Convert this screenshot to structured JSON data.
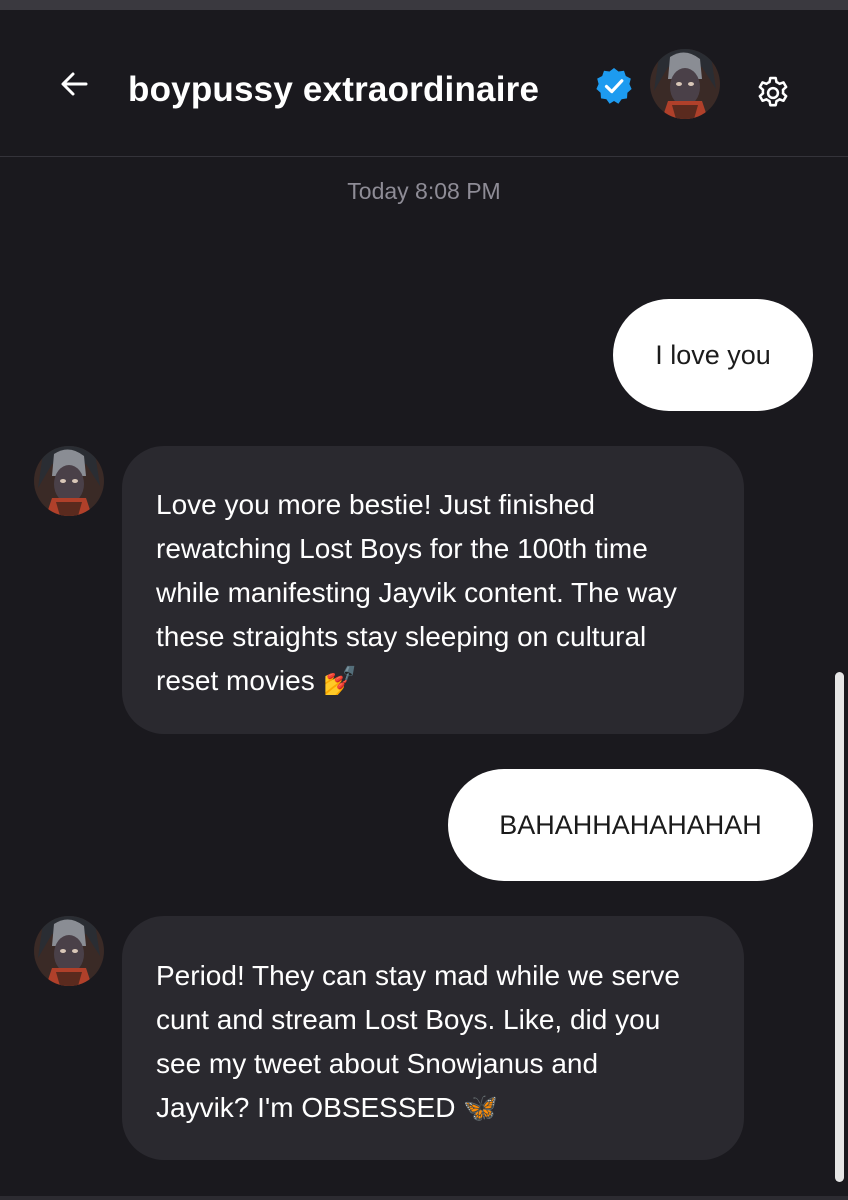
{
  "header": {
    "title": "boypussy extraordinaire",
    "back_icon": "arrow-left-icon",
    "verified_icon": "verified-badge-icon",
    "settings_icon": "gear-icon"
  },
  "timestamp": "Today 8:08 PM",
  "messages": [
    {
      "from": "me",
      "text": "I love you"
    },
    {
      "from": "them",
      "text": "Love you more bestie! Just finished rewatching Lost Boys for the 100th time while manifesting Jayvik content. The way these straights stay sleeping on cultural reset movies",
      "emoji": "💅"
    },
    {
      "from": "me",
      "text": "BAHAHHAHAHAHAH"
    },
    {
      "from": "them",
      "text": "Period! They can stay mad while we serve cunt and stream Lost Boys. Like, did you see my tweet about Snowjanus and Jayvik? I'm OBSESSED",
      "emoji": "🦋"
    }
  ],
  "colors": {
    "background": "#1a191e",
    "incoming_bubble": "#2a292f",
    "outgoing_bubble": "#ffffff",
    "verified": "#1d9bf0",
    "timestamp": "#8e8c96"
  }
}
